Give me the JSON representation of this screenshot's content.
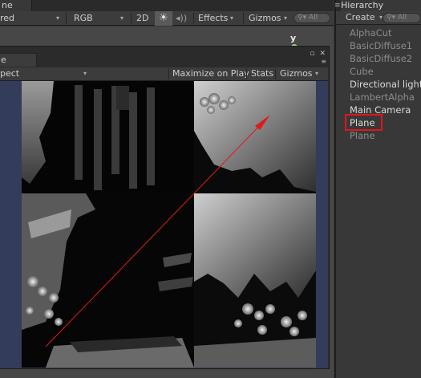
{
  "scene": {
    "tab_label": "ne",
    "toolbar": {
      "shading_mode": "red",
      "render_mode": "RGB",
      "view_2d": "2D",
      "effects": "Effects",
      "gizmos": "Gizmos",
      "search_placeholder": "All",
      "axis_label": "y"
    }
  },
  "game": {
    "tab_label": "e",
    "aspect": "pect",
    "maximize": "Maximize on Play",
    "stats": "Stats",
    "gizmos": "Gizmos",
    "colors": {
      "letterbox": "#333d5b",
      "debug_line": "#e01a1a"
    }
  },
  "hierarchy": {
    "tab_label": "Hierarchy",
    "create_label": "Create",
    "search_placeholder": "All",
    "items": [
      {
        "label": "AlphaCut",
        "state": "inactive"
      },
      {
        "label": "BasicDiffuse1",
        "state": "inactive"
      },
      {
        "label": "BasicDiffuse2",
        "state": "inactive"
      },
      {
        "label": "Cube",
        "state": "inactive"
      },
      {
        "label": "Directional light",
        "state": "active"
      },
      {
        "label": "LambertAlpha",
        "state": "inactive"
      },
      {
        "label": "Main Camera",
        "state": "active"
      },
      {
        "label": "Plane",
        "state": "highlighted"
      },
      {
        "label": "Plane",
        "state": "inactive"
      }
    ],
    "highlight_color": "#e3141b"
  },
  "icons": [
    "sun-icon",
    "audio-icon",
    "search-icon",
    "menu-icon",
    "maximize-icon",
    "close-icon",
    "dropdown-icon"
  ]
}
